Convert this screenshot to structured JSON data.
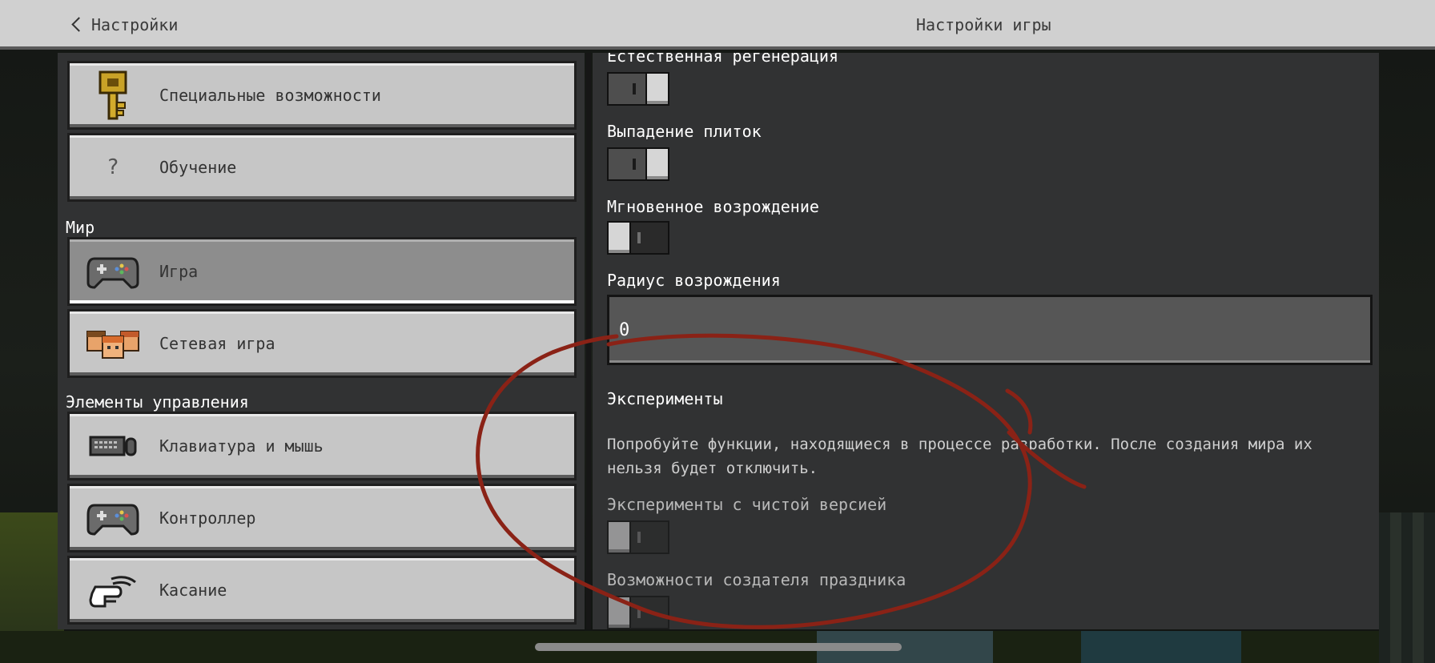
{
  "header": {
    "back_label": "Настройки",
    "title": "Настройки игры"
  },
  "sidebar": {
    "items_top": [
      {
        "label": "Специальные возможности",
        "icon": "key-icon"
      },
      {
        "label": "Обучение",
        "icon": "question-icon"
      }
    ],
    "section_world": "Мир",
    "items_world": [
      {
        "label": "Игра",
        "icon": "gamepad-icon",
        "active": true
      },
      {
        "label": "Сетевая игра",
        "icon": "players-icon"
      }
    ],
    "section_controls": "Элементы управления",
    "items_controls": [
      {
        "label": "Клавиатура и мышь",
        "icon": "keyboard-mouse-icon"
      },
      {
        "label": "Контроллер",
        "icon": "gamepad-icon"
      },
      {
        "label": "Касание",
        "icon": "touch-icon"
      }
    ]
  },
  "main": {
    "natural_regen_label": "Естественная регенерация",
    "natural_regen_on": true,
    "tile_drops_label": "Выпадение плиток",
    "tile_drops_on": true,
    "instant_respawn_label": "Мгновенное возрождение",
    "instant_respawn_on": false,
    "respawn_radius_label": "Радиус возрождения",
    "respawn_radius_value": "0",
    "experiments_heading": "Эксперименты",
    "experiments_desc": "Попробуйте функции, находящиеся в процессе разработки. После создания мира их нельзя будет отключить.",
    "vanilla_experiments_label": "Эксперименты с чистой версией",
    "vanilla_experiments_on": false,
    "holiday_creator_label": "Возможности создателя праздника",
    "holiday_creator_on": false
  },
  "colors": {
    "annotation_stroke": "#8a2216",
    "panel": "#313233",
    "button": "#c6c6c6",
    "button_active": "#8d8d8d",
    "topbar": "#d0d0d0"
  }
}
